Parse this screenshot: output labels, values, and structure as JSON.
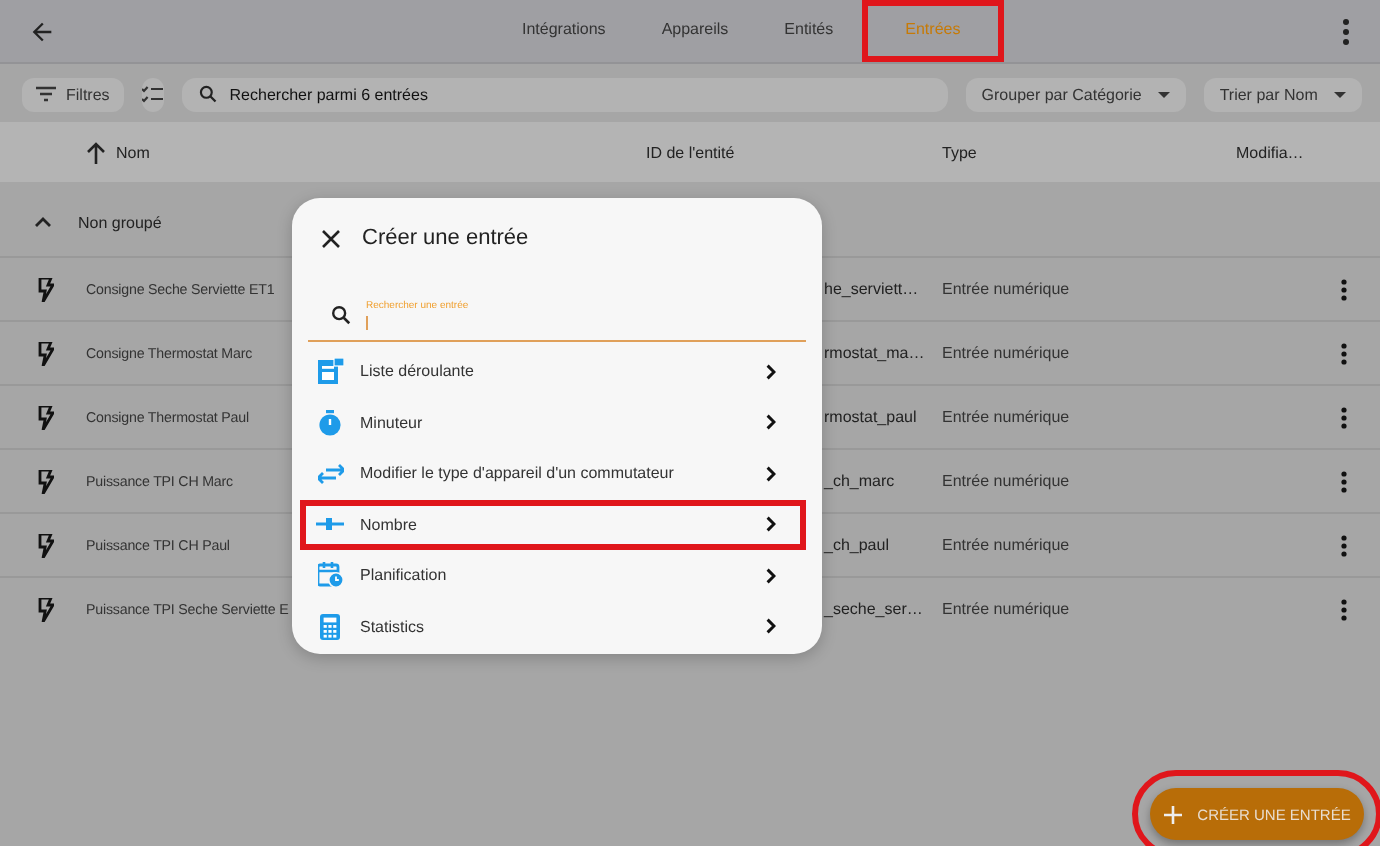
{
  "tabs": [
    {
      "label": "Intégrations",
      "selected": false,
      "highlighted": false
    },
    {
      "label": "Appareils",
      "selected": false,
      "highlighted": false
    },
    {
      "label": "Entités",
      "selected": false,
      "highlighted": false
    },
    {
      "label": "Entrées",
      "selected": true,
      "highlighted": true
    }
  ],
  "toolbar": {
    "filters_label": "Filtres",
    "search": {
      "placeholder": "Rechercher parmi 6 entrées"
    },
    "group_by": "Grouper par Catégorie",
    "sort_by": "Trier par Nom"
  },
  "table": {
    "columns": [
      "Nom",
      "ID de l'entité",
      "Type",
      "Modifia…"
    ],
    "group": {
      "label": "Non groupé",
      "expanded": true
    },
    "rows": [
      {
        "name": "Consigne Seche Serviette ET1",
        "entity_id": "he_serviett…",
        "type": "Entrée numérique"
      },
      {
        "name": "Consigne Thermostat Marc",
        "entity_id": "rmostat_ma…",
        "type": "Entrée numérique"
      },
      {
        "name": "Consigne Thermostat Paul",
        "entity_id": "rmostat_paul",
        "type": "Entrée numérique"
      },
      {
        "name": "Puissance TPI CH Marc",
        "entity_id": "_ch_marc",
        "type": "Entrée numérique"
      },
      {
        "name": "Puissance TPI CH Paul",
        "entity_id": "_ch_paul",
        "type": "Entrée numérique"
      },
      {
        "name": "Puissance TPI Seche Serviette E",
        "entity_id": "_seche_ser…",
        "type": "Entrée numérique"
      }
    ]
  },
  "dialog": {
    "title": "Créer une entrée",
    "search": {
      "label": "Rechercher une entrée"
    },
    "items": [
      {
        "kind": "dropdown",
        "label": "Liste déroulante",
        "highlighted": false
      },
      {
        "kind": "timer",
        "label": "Minuteur",
        "highlighted": false
      },
      {
        "kind": "switch",
        "label": "Modifier le type d'appareil d'un commutateur",
        "highlighted": false
      },
      {
        "kind": "number",
        "label": "Nombre",
        "highlighted": true
      },
      {
        "kind": "schedule",
        "label": "Planification",
        "highlighted": false
      },
      {
        "kind": "statistics",
        "label": "Statistics",
        "highlighted": false
      }
    ]
  },
  "fab": {
    "label": "CRÉER UNE ENTRÉE",
    "highlighted": true
  }
}
